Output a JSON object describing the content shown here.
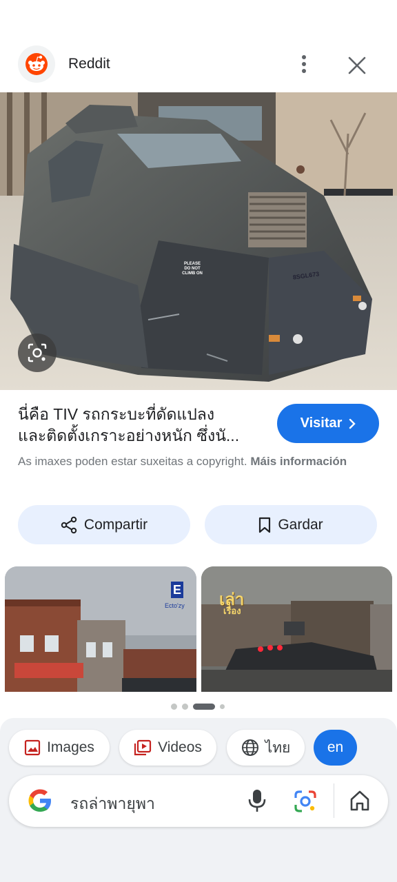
{
  "header": {
    "source_name": "Reddit",
    "more_icon": "more-vert-icon",
    "close_icon": "close-icon"
  },
  "result": {
    "title_line1": "นี่คือ TIV รถกระบะที่ดัดแปลง",
    "title_line2": "และติดตั้งเกราะอย่างหนัก ซึ่งนั...",
    "visit_label": "Visitar",
    "copyright_text": "As imaxes poden estar suxeitas a copyright.",
    "copyright_link": "Máis información",
    "image_sign_text": "PLEASE DO NOT CLIMB ON",
    "plate_text": "8SGL673"
  },
  "actions": {
    "share_label": "Compartir",
    "save_label": "Gardar"
  },
  "related": {
    "thumb1_logo": "E",
    "thumb1_caption": "Ecto'zy",
    "thumb2_caption_1": "เล่า",
    "thumb2_caption_2": "เรื่อง"
  },
  "carousel": {
    "count": 4,
    "active_index": 2
  },
  "chips": {
    "images": "Images",
    "videos": "Videos",
    "thai": "ไทย",
    "en": "en"
  },
  "search": {
    "query": "รถล่าพายุพา"
  },
  "colors": {
    "accent": "#1a73e8",
    "reddit": "#ff4500",
    "chip_bg": "#e8f0fe"
  }
}
